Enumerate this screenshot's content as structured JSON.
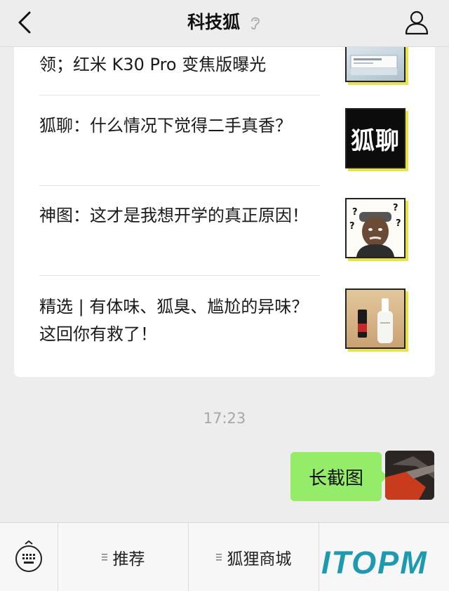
{
  "nav": {
    "title": "科技狐"
  },
  "articles": [
    {
      "text": "领；红米 K30 Pro 变焦版曝光",
      "thumb": "phone-box-photo"
    },
    {
      "text": "狐聊：什么情况下觉得二手真香？",
      "thumb": "fox-chat-badge",
      "thumb_label": "狐聊"
    },
    {
      "text": "神图：这才是我想开学的真正原因！",
      "thumb": "confused-man-meme",
      "meme_marks": [
        "?",
        "?",
        "?",
        "?"
      ]
    },
    {
      "text": "精选 | 有体味、狐臭、尴尬的异味？这回你有救了！",
      "thumb": "deodorant-bottles-photo"
    }
  ],
  "timestamp": "17:23",
  "message": {
    "text": "长截图"
  },
  "bottom_menu": {
    "keyboard_icon": "keyboard-icon",
    "items": [
      {
        "label": "推荐"
      },
      {
        "label": "狐狸商城"
      }
    ]
  },
  "watermark": "ITOPM",
  "colors": {
    "background": "#ededed",
    "bubble": "#95ec69",
    "thumb_shadow": "#e8e34a",
    "watermark": "#1e9ab0"
  }
}
